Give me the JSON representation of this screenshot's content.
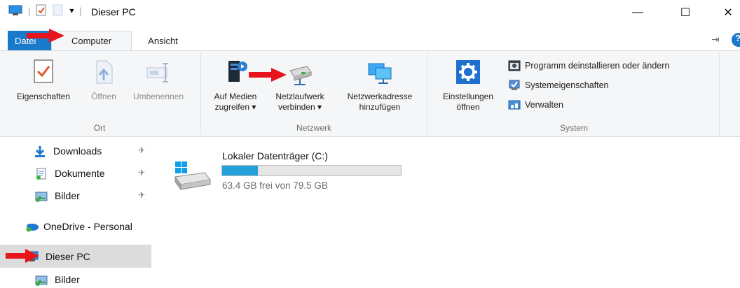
{
  "window": {
    "title": "Dieser PC",
    "minimize_glyph": "—",
    "maximize_glyph": "☐",
    "close_glyph": "✕",
    "qa_dropdown_glyph": "▾",
    "qa_separator": "|"
  },
  "tabs": {
    "file_label": "Datei",
    "computer_label": "Computer",
    "view_label": "Ansicht",
    "pin_glyph": "⇥",
    "help_glyph": "?"
  },
  "ribbon": {
    "groups": {
      "ort": {
        "label": "Ort",
        "properties_label": "Eigenschaften",
        "open_label": "Öffnen",
        "rename_label": "Umbenennen"
      },
      "netzwerk": {
        "label": "Netzwerk",
        "media_line1": "Auf Medien",
        "media_line2": "zugreifen ▾",
        "map_drive_line1": "Netzlaufwerk",
        "map_drive_line2": "verbinden ▾",
        "add_location_line1": "Netzwerkadresse",
        "add_location_line2": "hinzufügen"
      },
      "system": {
        "label": "System",
        "settings_line1": "Einstellungen",
        "settings_line2": "öffnen",
        "uninstall_label": "Programm deinstallieren oder ändern",
        "system_props_label": "Systemeigenschaften",
        "manage_label": "Verwalten"
      }
    }
  },
  "nav": {
    "downloads": "Downloads",
    "documents": "Dokumente",
    "pictures": "Bilder",
    "onedrive": "OneDrive - Personal",
    "this_pc": "Dieser PC",
    "pictures2": "Bilder",
    "pin_glyph": "✈"
  },
  "drive": {
    "name": "Lokaler Datenträger (C:)",
    "free_text": "63.4 GB frei von 79.5 GB",
    "used_fraction": 0.2
  },
  "colors": {
    "accent": "#1979ca",
    "bar_fill": "#26a0da",
    "arrow": "#e8141c"
  }
}
